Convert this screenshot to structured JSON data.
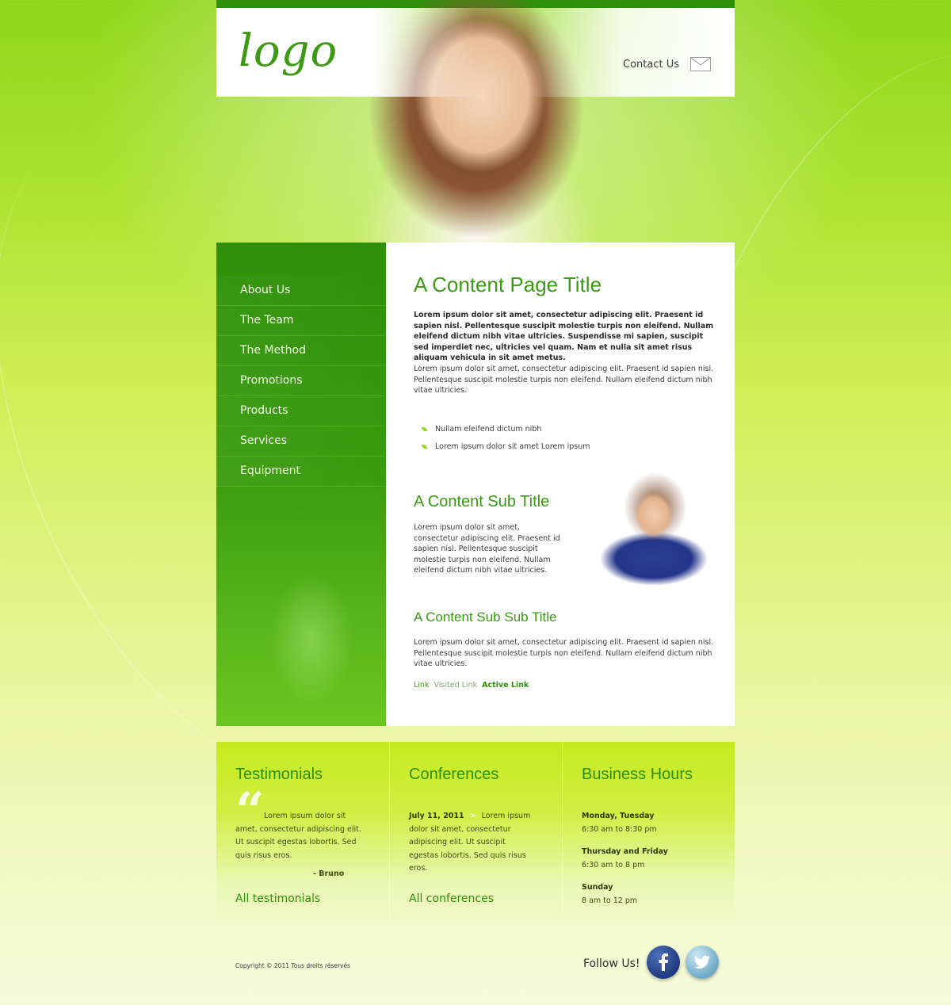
{
  "header": {
    "logo": "logo",
    "contact_label": "Contact Us"
  },
  "nav": {
    "items": [
      "About Us",
      "The Team",
      "The Method",
      "Promotions",
      "Products",
      "Services",
      "Equipment"
    ]
  },
  "content": {
    "title": "A Content Page Title",
    "intro_bold": "Lorem ipsum dolor sit amet, consectetur adipiscing elit. Praesent id sapien nisl. Pellentesque suscipit molestie turpis non eleifend. Nullam eleifend dictum nibh vitae ultricies. Suspendisse mi sapien, suscipit sed imperdiet nec, ultricies vel quam. Nam et nulla sit amet risus aliquam vehicula in sit amet metus.",
    "paragraph": "Lorem ipsum dolor sit amet, consectetur adipiscing elit. Praesent id sapien nisl. Pellentesque suscipit molestie turpis non eleifend. Nullam eleifend dictum nibh vitae ultricies.",
    "bullets": [
      "Nullam eleifend dictum nibh",
      "Lorem ipsum dolor sit amet Lorem ipsum"
    ],
    "sub_title": "A Content Sub Title",
    "sub_paragraph": "Lorem ipsum dolor sit amet, consectetur adipiscing elit. Praesent id sapien nisl. Pellentesque suscipit molestie turpis non eleifend. Nullam eleifend dictum nibh vitae ultricies.",
    "sub_sub_title": "A Content Sub Sub Title",
    "sub_sub_paragraph": "Lorem ipsum dolor sit amet, consectetur adipiscing elit. Praesent id sapien nisl. Pellentesque suscipit molestie turpis non eleifend. Nullam eleifend dictum nibh vitae ultricies.",
    "links": {
      "link": "Link",
      "visited": "Visited Link",
      "active": "Active Link"
    }
  },
  "footer": {
    "testimonials": {
      "title": "Testimonials",
      "text": "Lorem ipsum dolor sit amet, consectetur adipiscing elit. Ut suscipit egestas lobortis. Sed quis risus eros.",
      "author": "- Bruno",
      "more": "All testimonials"
    },
    "conferences": {
      "title": "Conferences",
      "date": "July 11, 2011",
      "separator": ">",
      "text": "Lorem ipsum dolor sit amet, consectetur adipiscing elit. Ut suscipit egestas lobortis. Sed quis risus eros.",
      "more": "All conferences"
    },
    "hours": {
      "title": "Business Hours",
      "entries": [
        {
          "day": "Monday, Tuesday",
          "time": "6:30 am to 8:30 pm"
        },
        {
          "day": "Thursday and Friday",
          "time": "6:30 am to 8 pm"
        },
        {
          "day": "Sunday",
          "time": "8 am to 12 pm"
        }
      ]
    }
  },
  "bottom": {
    "copyright": "Copyright © 2011 Tous droits réservés",
    "follow": "Follow Us!"
  },
  "colors": {
    "brand_green": "#3a9a12",
    "nav_green": "#2f8f0a",
    "link": "#3a9a12",
    "visited_link": "#8aa27a",
    "active_link": "#2f8f0a"
  },
  "icons": {
    "contact": "mail-icon",
    "bullet": "leaf-icon",
    "quote": "quote-icon",
    "facebook": "facebook-icon",
    "twitter": "twitter-icon"
  }
}
